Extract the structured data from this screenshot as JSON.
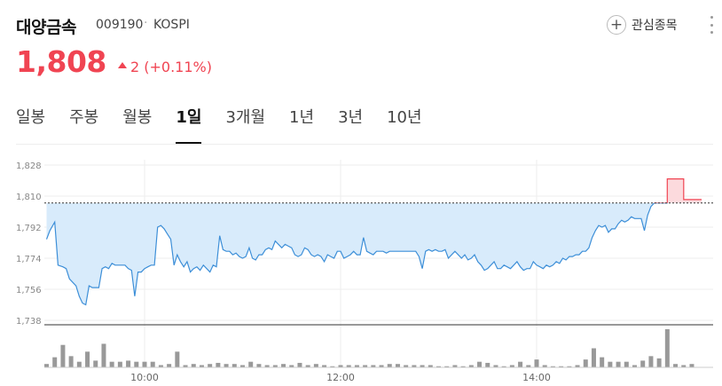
{
  "header": {
    "stock_name": "대양금속",
    "stock_code": "009190",
    "market": "KOSPI",
    "favorite_label": "관심종목"
  },
  "price": {
    "current": "1,808",
    "change": "2 (+0.11%)"
  },
  "tabs": [
    {
      "label": "일봉",
      "active": false
    },
    {
      "label": "주봉",
      "active": false
    },
    {
      "label": "월봉",
      "active": false
    },
    {
      "label": "1일",
      "active": true
    },
    {
      "label": "3개월",
      "active": false
    },
    {
      "label": "1년",
      "active": false
    },
    {
      "label": "3년",
      "active": false
    },
    {
      "label": "10년",
      "active": false
    }
  ],
  "colors": {
    "up": "#f04452",
    "down_line": "#3d8fd8",
    "down_fill": "#d8ebfb",
    "up_fill": "#fcdadd",
    "volume": "#999999"
  },
  "chart_data": {
    "type": "area",
    "y_ticks": [
      "1,828",
      "1,810",
      "1,792",
      "1,774",
      "1,756",
      "1,738"
    ],
    "ylim": [
      1738,
      1828
    ],
    "x_ticks": [
      "10:00",
      "12:00",
      "14:00"
    ],
    "xlim": [
      "09:00",
      "15:20"
    ],
    "base_price": 1806,
    "series": [
      {
        "values": [
          [
            "09:00",
            1785
          ],
          [
            "09:02",
            1790
          ],
          [
            "09:05",
            1795
          ],
          [
            "09:07",
            1770
          ],
          [
            "09:10",
            1769
          ],
          [
            "09:12",
            1768
          ],
          [
            "09:14",
            1762
          ],
          [
            "09:16",
            1760
          ],
          [
            "09:18",
            1758
          ],
          [
            "09:20",
            1752
          ],
          [
            "09:22",
            1748
          ],
          [
            "09:24",
            1747
          ],
          [
            "09:26",
            1758
          ],
          [
            "09:28",
            1757
          ],
          [
            "09:30",
            1757
          ],
          [
            "09:32",
            1757
          ],
          [
            "09:34",
            1768
          ],
          [
            "09:36",
            1769
          ],
          [
            "09:38",
            1768
          ],
          [
            "09:40",
            1771
          ],
          [
            "09:42",
            1770
          ],
          [
            "09:44",
            1770
          ],
          [
            "09:46",
            1770
          ],
          [
            "09:48",
            1770
          ],
          [
            "09:50",
            1768
          ],
          [
            "09:52",
            1767
          ],
          [
            "09:54",
            1752
          ],
          [
            "09:56",
            1766
          ],
          [
            "09:58",
            1766
          ],
          [
            "10:00",
            1768
          ],
          [
            "10:02",
            1769
          ],
          [
            "10:04",
            1770
          ],
          [
            "10:06",
            1770
          ],
          [
            "10:08",
            1792
          ],
          [
            "10:10",
            1793
          ],
          [
            "10:12",
            1791
          ],
          [
            "10:14",
            1788
          ],
          [
            "10:16",
            1785
          ],
          [
            "10:18",
            1770
          ],
          [
            "10:20",
            1776
          ],
          [
            "10:22",
            1772
          ],
          [
            "10:24",
            1769
          ],
          [
            "10:26",
            1772
          ],
          [
            "10:28",
            1766
          ],
          [
            "10:30",
            1768
          ],
          [
            "10:32",
            1769
          ],
          [
            "10:34",
            1767
          ],
          [
            "10:36",
            1770
          ],
          [
            "10:38",
            1768
          ],
          [
            "10:40",
            1766
          ],
          [
            "10:42",
            1770
          ],
          [
            "10:44",
            1769
          ],
          [
            "10:46",
            1787
          ],
          [
            "10:48",
            1779
          ],
          [
            "10:50",
            1778
          ],
          [
            "10:52",
            1778
          ],
          [
            "10:54",
            1776
          ],
          [
            "10:56",
            1777
          ],
          [
            "10:58",
            1775
          ],
          [
            "11:00",
            1774
          ],
          [
            "11:02",
            1775
          ],
          [
            "11:04",
            1780
          ],
          [
            "11:06",
            1774
          ],
          [
            "11:08",
            1773
          ],
          [
            "11:10",
            1776
          ],
          [
            "11:12",
            1776
          ],
          [
            "11:14",
            1779
          ],
          [
            "11:16",
            1780
          ],
          [
            "11:18",
            1779
          ],
          [
            "11:20",
            1784
          ],
          [
            "11:22",
            1782
          ],
          [
            "11:24",
            1780
          ],
          [
            "11:26",
            1782
          ],
          [
            "11:28",
            1781
          ],
          [
            "11:30",
            1780
          ],
          [
            "11:32",
            1776
          ],
          [
            "11:34",
            1775
          ],
          [
            "11:36",
            1776
          ],
          [
            "11:38",
            1780
          ],
          [
            "11:40",
            1779
          ],
          [
            "11:42",
            1776
          ],
          [
            "11:44",
            1775
          ],
          [
            "11:46",
            1776
          ],
          [
            "11:48",
            1775
          ],
          [
            "11:50",
            1772
          ],
          [
            "11:52",
            1776
          ],
          [
            "11:54",
            1775
          ],
          [
            "11:56",
            1774
          ],
          [
            "11:58",
            1778
          ],
          [
            "12:00",
            1778
          ],
          [
            "12:02",
            1774
          ],
          [
            "12:04",
            1775
          ],
          [
            "12:06",
            1776
          ],
          [
            "12:08",
            1778
          ],
          [
            "12:10",
            1776
          ],
          [
            "12:12",
            1776
          ],
          [
            "12:14",
            1786
          ],
          [
            "12:16",
            1778
          ],
          [
            "12:18",
            1777
          ],
          [
            "12:20",
            1776
          ],
          [
            "12:22",
            1778
          ],
          [
            "12:24",
            1778
          ],
          [
            "12:26",
            1778
          ],
          [
            "12:28",
            1777
          ],
          [
            "12:30",
            1778
          ],
          [
            "12:32",
            1778
          ],
          [
            "12:34",
            1778
          ],
          [
            "12:36",
            1778
          ],
          [
            "12:38",
            1778
          ],
          [
            "12:40",
            1778
          ],
          [
            "12:42",
            1778
          ],
          [
            "12:44",
            1778
          ],
          [
            "12:46",
            1778
          ],
          [
            "12:48",
            1775
          ],
          [
            "12:50",
            1768
          ],
          [
            "12:52",
            1778
          ],
          [
            "12:54",
            1779
          ],
          [
            "12:56",
            1778
          ],
          [
            "12:58",
            1779
          ],
          [
            "13:00",
            1778
          ],
          [
            "13:02",
            1778
          ],
          [
            "13:04",
            1779
          ],
          [
            "13:06",
            1774
          ],
          [
            "13:08",
            1776
          ],
          [
            "13:10",
            1778
          ],
          [
            "13:12",
            1776
          ],
          [
            "13:14",
            1774
          ],
          [
            "13:16",
            1776
          ],
          [
            "13:18",
            1773
          ],
          [
            "13:20",
            1774
          ],
          [
            "13:22",
            1776
          ],
          [
            "13:24",
            1772
          ],
          [
            "13:26",
            1770
          ],
          [
            "13:28",
            1767
          ],
          [
            "13:30",
            1768
          ],
          [
            "13:32",
            1770
          ],
          [
            "13:34",
            1772
          ],
          [
            "13:36",
            1768
          ],
          [
            "13:38",
            1768
          ],
          [
            "13:40",
            1770
          ],
          [
            "13:42",
            1769
          ],
          [
            "13:44",
            1768
          ],
          [
            "13:46",
            1770
          ],
          [
            "13:48",
            1772
          ],
          [
            "13:50",
            1769
          ],
          [
            "13:52",
            1767
          ],
          [
            "13:54",
            1768
          ],
          [
            "13:56",
            1768
          ],
          [
            "13:58",
            1772
          ],
          [
            "14:00",
            1770
          ],
          [
            "14:02",
            1769
          ],
          [
            "14:04",
            1768
          ],
          [
            "14:06",
            1770
          ],
          [
            "14:08",
            1769
          ],
          [
            "14:10",
            1770
          ],
          [
            "14:12",
            1772
          ],
          [
            "14:14",
            1771
          ],
          [
            "14:16",
            1774
          ],
          [
            "14:18",
            1773
          ],
          [
            "14:20",
            1775
          ],
          [
            "14:22",
            1775
          ],
          [
            "14:24",
            1776
          ],
          [
            "14:26",
            1776
          ],
          [
            "14:28",
            1778
          ],
          [
            "14:30",
            1778
          ],
          [
            "14:32",
            1780
          ],
          [
            "14:34",
            1786
          ],
          [
            "14:36",
            1790
          ],
          [
            "14:38",
            1793
          ],
          [
            "14:40",
            1792
          ],
          [
            "14:42",
            1793
          ],
          [
            "14:44",
            1789
          ],
          [
            "14:46",
            1791
          ],
          [
            "14:48",
            1791
          ],
          [
            "14:50",
            1794
          ],
          [
            "14:52",
            1796
          ],
          [
            "14:54",
            1795
          ],
          [
            "14:56",
            1796
          ],
          [
            "14:58",
            1798
          ],
          [
            "15:00",
            1797
          ],
          [
            "15:02",
            1797
          ],
          [
            "15:04",
            1797
          ],
          [
            "15:06",
            1790
          ],
          [
            "15:08",
            1799
          ],
          [
            "15:10",
            1804
          ],
          [
            "15:12",
            1806
          ],
          [
            "15:14",
            1806
          ],
          [
            "15:16",
            1806
          ],
          [
            "15:20",
            1806
          ],
          [
            "15:20",
            1820
          ],
          [
            "15:30",
            1820
          ],
          [
            "15:30",
            1808
          ],
          [
            "15:41",
            1808
          ]
        ]
      },
      {
        "name": "volume",
        "values": [
          [
            "09:00",
            3
          ],
          [
            "09:05",
            9
          ],
          [
            "09:10",
            20
          ],
          [
            "09:15",
            10
          ],
          [
            "09:20",
            5
          ],
          [
            "09:25",
            14
          ],
          [
            "09:30",
            6
          ],
          [
            "09:35",
            21
          ],
          [
            "09:40",
            5
          ],
          [
            "09:45",
            5
          ],
          [
            "09:50",
            6
          ],
          [
            "09:55",
            5
          ],
          [
            "10:00",
            5
          ],
          [
            "10:05",
            5
          ],
          [
            "10:10",
            2
          ],
          [
            "10:15",
            3
          ],
          [
            "10:20",
            14
          ],
          [
            "10:25",
            2
          ],
          [
            "10:30",
            3
          ],
          [
            "10:35",
            2
          ],
          [
            "10:40",
            3
          ],
          [
            "10:45",
            4
          ],
          [
            "10:50",
            3
          ],
          [
            "10:55",
            3
          ],
          [
            "11:00",
            2
          ],
          [
            "11:05",
            5
          ],
          [
            "11:10",
            3
          ],
          [
            "11:15",
            2
          ],
          [
            "11:20",
            2
          ],
          [
            "11:25",
            3
          ],
          [
            "11:30",
            2
          ],
          [
            "11:35",
            4
          ],
          [
            "11:40",
            2
          ],
          [
            "11:45",
            3
          ],
          [
            "11:50",
            2
          ],
          [
            "11:55",
            1
          ],
          [
            "12:00",
            2
          ],
          [
            "12:05",
            2
          ],
          [
            "12:10",
            2
          ],
          [
            "12:15",
            2
          ],
          [
            "12:20",
            2
          ],
          [
            "12:25",
            2
          ],
          [
            "12:30",
            3
          ],
          [
            "12:35",
            3
          ],
          [
            "12:40",
            2
          ],
          [
            "12:45",
            2
          ],
          [
            "12:50",
            2
          ],
          [
            "12:55",
            2
          ],
          [
            "13:00",
            1
          ],
          [
            "13:05",
            1
          ],
          [
            "13:10",
            2
          ],
          [
            "13:15",
            1
          ],
          [
            "13:20",
            2
          ],
          [
            "13:25",
            5
          ],
          [
            "13:30",
            4
          ],
          [
            "13:35",
            2
          ],
          [
            "13:40",
            1
          ],
          [
            "13:45",
            2
          ],
          [
            "13:50",
            5
          ],
          [
            "13:55",
            2
          ],
          [
            "14:00",
            7
          ],
          [
            "14:05",
            2
          ],
          [
            "14:10",
            1
          ],
          [
            "14:15",
            1
          ],
          [
            "14:20",
            1
          ],
          [
            "14:25",
            2
          ],
          [
            "14:30",
            7
          ],
          [
            "14:35",
            17
          ],
          [
            "14:40",
            9
          ],
          [
            "14:45",
            5
          ],
          [
            "14:50",
            5
          ],
          [
            "14:55",
            5
          ],
          [
            "15:00",
            2
          ],
          [
            "15:05",
            6
          ],
          [
            "15:10",
            10
          ],
          [
            "15:15",
            8
          ],
          [
            "15:20",
            34
          ],
          [
            "15:25",
            3
          ],
          [
            "15:30",
            2
          ],
          [
            "15:35",
            3
          ]
        ]
      }
    ]
  }
}
